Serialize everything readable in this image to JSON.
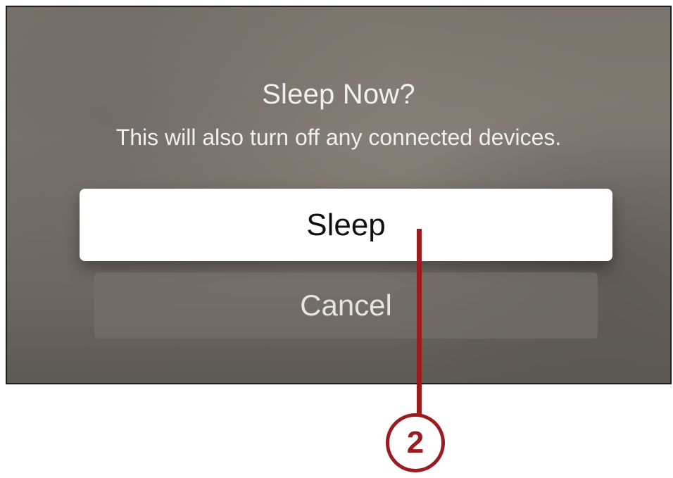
{
  "dialog": {
    "title": "Sleep Now?",
    "message": "This will also turn off any connected devices.",
    "buttons": {
      "sleep_label": "Sleep",
      "cancel_label": "Cancel"
    }
  },
  "callout": {
    "number": "2",
    "color": "#9b1c20"
  }
}
